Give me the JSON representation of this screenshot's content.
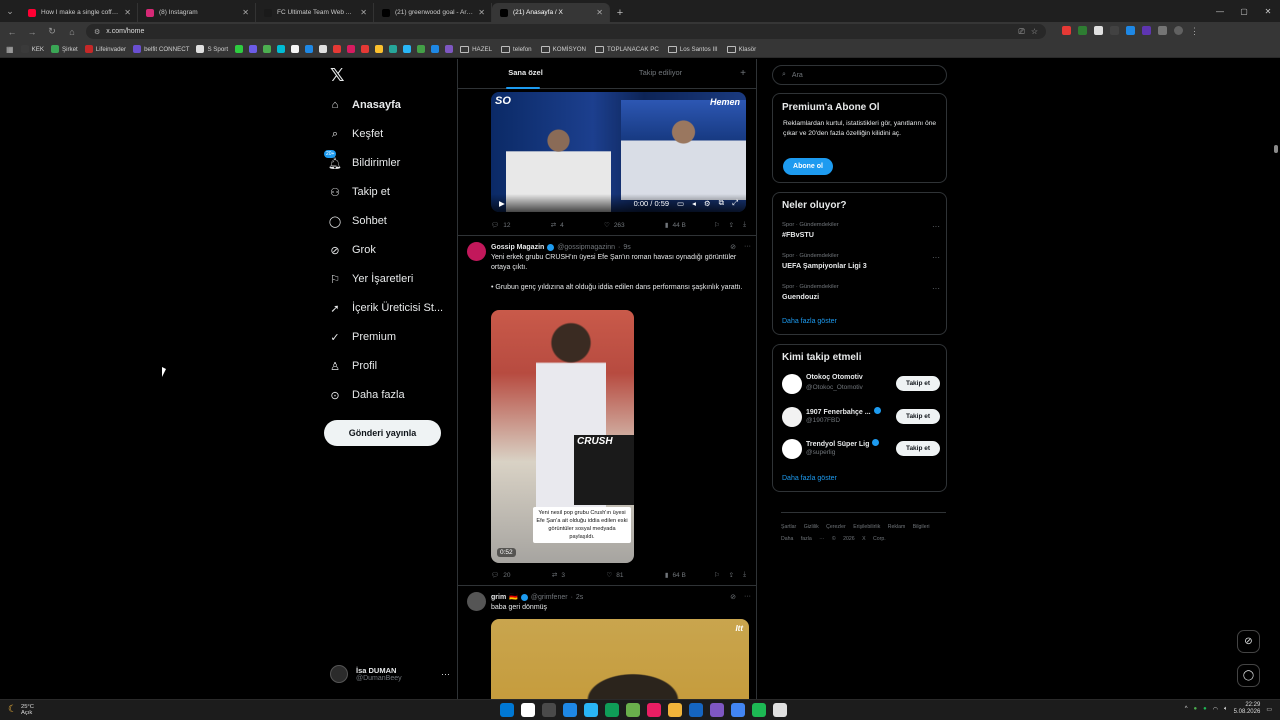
{
  "browser": {
    "tabs": [
      {
        "title": "How I make a single coffee every",
        "color": "#ff0033",
        "active": false
      },
      {
        "title": "(8) Instagram",
        "color": "#d62976",
        "active": false
      },
      {
        "title": "FC Ultimate Team Web App - E",
        "color": "#1a1a1a",
        "active": false
      },
      {
        "title": "(21) greenwood goal - Arama / X",
        "color": "#000000",
        "active": false
      },
      {
        "title": "(21) Anasayfa / X",
        "color": "#000000",
        "active": true
      }
    ],
    "url": "x.com/home",
    "bookmarks": [
      {
        "label": "KEK",
        "color": "#3a3a3a"
      },
      {
        "label": "Şirket",
        "color": "#3aa655"
      },
      {
        "label": "Lifeinvader",
        "color": "#c62828"
      },
      {
        "label": "belfit CONNECT",
        "color": "#6a4fd1"
      },
      {
        "label": "S Sport",
        "color": "#e0e0e0"
      }
    ],
    "bookmark_icons": [
      "#2ecc40",
      "#6c5ce7",
      "#4caf50",
      "#00bcd4",
      "#f5f5f5",
      "#1e88e5",
      "#e0e0e0",
      "#e53935",
      "#d81b60",
      "#e53935",
      "#fbc02d",
      "#26a69a",
      "#29b6f6",
      "#43a047",
      "#1e88e5",
      "#7e57c2"
    ],
    "folders": [
      "HAZEL",
      "telefon",
      "KOMİSYON",
      "TOPLANACAK PC",
      "Los Santos III",
      "Klasör"
    ]
  },
  "nav": {
    "items": [
      {
        "label": "Anasayfa",
        "icon": "home-icon",
        "active": true
      },
      {
        "label": "Keşfet",
        "icon": "search-icon",
        "active": false
      },
      {
        "label": "Bildirimler",
        "icon": "bell-icon",
        "active": false
      },
      {
        "label": "Takip et",
        "icon": "follow-icon",
        "active": false
      },
      {
        "label": "Sohbet",
        "icon": "chat-icon",
        "active": false
      },
      {
        "label": "Grok",
        "icon": "grok-icon",
        "active": false
      },
      {
        "label": "Yer İşaretleri",
        "icon": "bookmark-icon",
        "active": false
      },
      {
        "label": "İçerik Üreticisi St...",
        "icon": "rocket-icon",
        "active": false
      },
      {
        "label": "Premium",
        "icon": "premium-icon",
        "active": false
      },
      {
        "label": "Profil",
        "icon": "person-icon",
        "active": false
      },
      {
        "label": "Daha fazla",
        "icon": "more-circle-icon",
        "active": false
      }
    ],
    "notif_badge": "20+",
    "post_button": "Gönderi yayınla",
    "user_name": "İsa DUMAN",
    "user_handle": "@DumanBeey"
  },
  "timeline": {
    "tab_foryou": "Sana özel",
    "tab_following": "Takip ediliyor",
    "tweet1": {
      "video_time": "0:00 / 0:59",
      "brand": "Hemen",
      "logo": "SO",
      "replies": "12",
      "reposts": "4",
      "likes": "263",
      "views": "44 B"
    },
    "tweet2": {
      "name": "Gossip Magazin",
      "handle": "@gossipmagazinn",
      "time": "9s",
      "text1": "Yeni erkek grubu CRUSH'ın üyesi Efe Şan'ın roman havası oynadığı görüntüler ortaya çıktı.",
      "text2": "• Grubun genç yıldızına alt olduğu iddia edilen dans performansı şaşkınlık yarattı.",
      "image_caption": "Yeni nesil pop grubu Crush'ın üyesi Efe Şan'a ait olduğu iddia edilen eski görüntüler sosyal medyada paylaşıldı.",
      "image_brand": "CRUSH",
      "duration": "0:52",
      "replies": "20",
      "reposts": "3",
      "likes": "81",
      "views": "64 B"
    },
    "tweet3": {
      "name": "grim",
      "flag": "🇩🇪",
      "handle": "@grimfener",
      "time": "2s",
      "text": "baba geri dönmüş",
      "tag": "Itt"
    }
  },
  "sidebar": {
    "search_placeholder": "Ara",
    "premium_title": "Premium'a Abone Ol",
    "premium_body": "Reklamlardan kurtul, istatistikleri gör, yanıtlarını öne çıkar ve 20'den fazla özelliğin kilidini aç.",
    "premium_button": "Abone ol",
    "trends_title": "Neler oluyor?",
    "trends": [
      {
        "category": "Spor · Gündemdekiler",
        "title": "#FBvSTU"
      },
      {
        "category": "Spor · Gündemdekiler",
        "title": "UEFA Şampiyonlar Ligi 3"
      },
      {
        "category": "Spor · Gündemdekiler",
        "title": "Guendouzi"
      }
    ],
    "show_more": "Daha fazla göster",
    "follow_title": "Kimi takip etmeli",
    "follows": [
      {
        "name": "Otokoç Otomotiv",
        "handle": "@Otokoc_Otomotiv",
        "verified": false,
        "color": "#ffffff"
      },
      {
        "name": "1907 Fenerbahçe ...",
        "handle": "@1907FBD",
        "verified": true,
        "color": "#f2f2f2"
      },
      {
        "name": "Trendyol Süper Lig",
        "handle": "@superlig",
        "verified": true,
        "color": "#ffffff"
      }
    ],
    "follow_button": "Takip et",
    "footer": "Şartlar Gizlilik Çerezler Erişilebilirlik Reklam Bilgileri Daha fazla ··· © 2026 X Corp."
  },
  "taskbar": {
    "temp": "25°C",
    "weather": "Açık",
    "time": "22:29",
    "date": "5.08.2026",
    "app_colors": [
      "#0078d4",
      "#ffffff",
      "#4a4a4a",
      "#1e88e5",
      "#29b6f6",
      "#0f9d58",
      "#6ab04c",
      "#e91e63",
      "#f0b43a",
      "#1565c0",
      "#7e57c2",
      "#4285f4",
      "#1db954",
      "#e0e0e0"
    ]
  },
  "colors": {
    "accent": "#1d9bf0",
    "bg": "#000000",
    "border": "#2f3336"
  }
}
